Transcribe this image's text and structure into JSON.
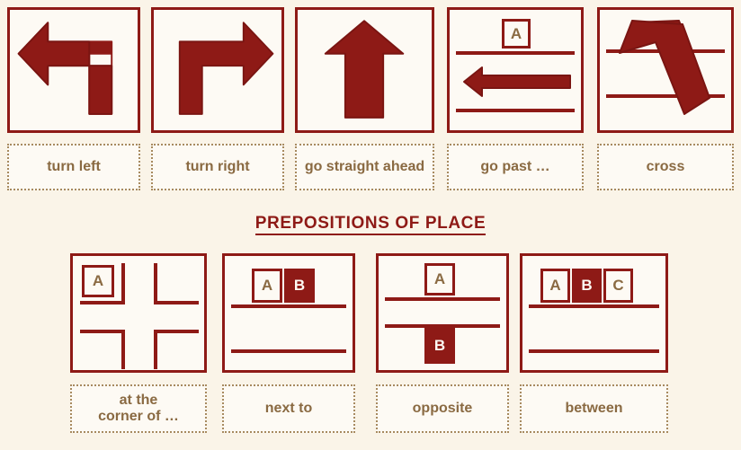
{
  "page": {
    "background_color": "#faf4e8",
    "accent_color": "#8e1a16",
    "label_text_color": "#8a6a42",
    "card_fill_color": "#fdfaf4"
  },
  "directions_row": {
    "items": [
      {
        "id": "turn-left",
        "label": "turn left",
        "icon": "arrow-turn-left-icon"
      },
      {
        "id": "turn-right",
        "label": "turn right",
        "icon": "arrow-turn-right-icon"
      },
      {
        "id": "go-straight-ahead",
        "label": "go straight ahead",
        "icon": "arrow-up-icon"
      },
      {
        "id": "go-past",
        "label": "go past …",
        "icon": "arrow-left-along-road-icon",
        "building": "A"
      },
      {
        "id": "cross",
        "label": "cross",
        "icon": "arrow-diagonal-across-road-icon"
      }
    ]
  },
  "section_heading": {
    "title": "PREPOSITIONS OF PLACE"
  },
  "prepositions_row": {
    "items": [
      {
        "id": "at-the-corner-of",
        "label_line1": "at the",
        "label_line2": "corner of …",
        "icon": "crossroads-corner-icon",
        "buildings": [
          {
            "letter": "A",
            "filled": false
          }
        ]
      },
      {
        "id": "next-to",
        "label": "next to",
        "icon": "two-buildings-side-by-side-icon",
        "buildings": [
          {
            "letter": "A",
            "filled": false
          },
          {
            "letter": "B",
            "filled": true
          }
        ]
      },
      {
        "id": "opposite",
        "label": "opposite",
        "icon": "buildings-across-road-icon",
        "buildings": [
          {
            "letter": "A",
            "filled": false
          },
          {
            "letter": "B",
            "filled": true
          }
        ]
      },
      {
        "id": "between",
        "label": "between",
        "icon": "three-buildings-in-a-row-icon",
        "buildings": [
          {
            "letter": "A",
            "filled": false
          },
          {
            "letter": "B",
            "filled": true
          },
          {
            "letter": "C",
            "filled": false
          }
        ]
      }
    ]
  }
}
